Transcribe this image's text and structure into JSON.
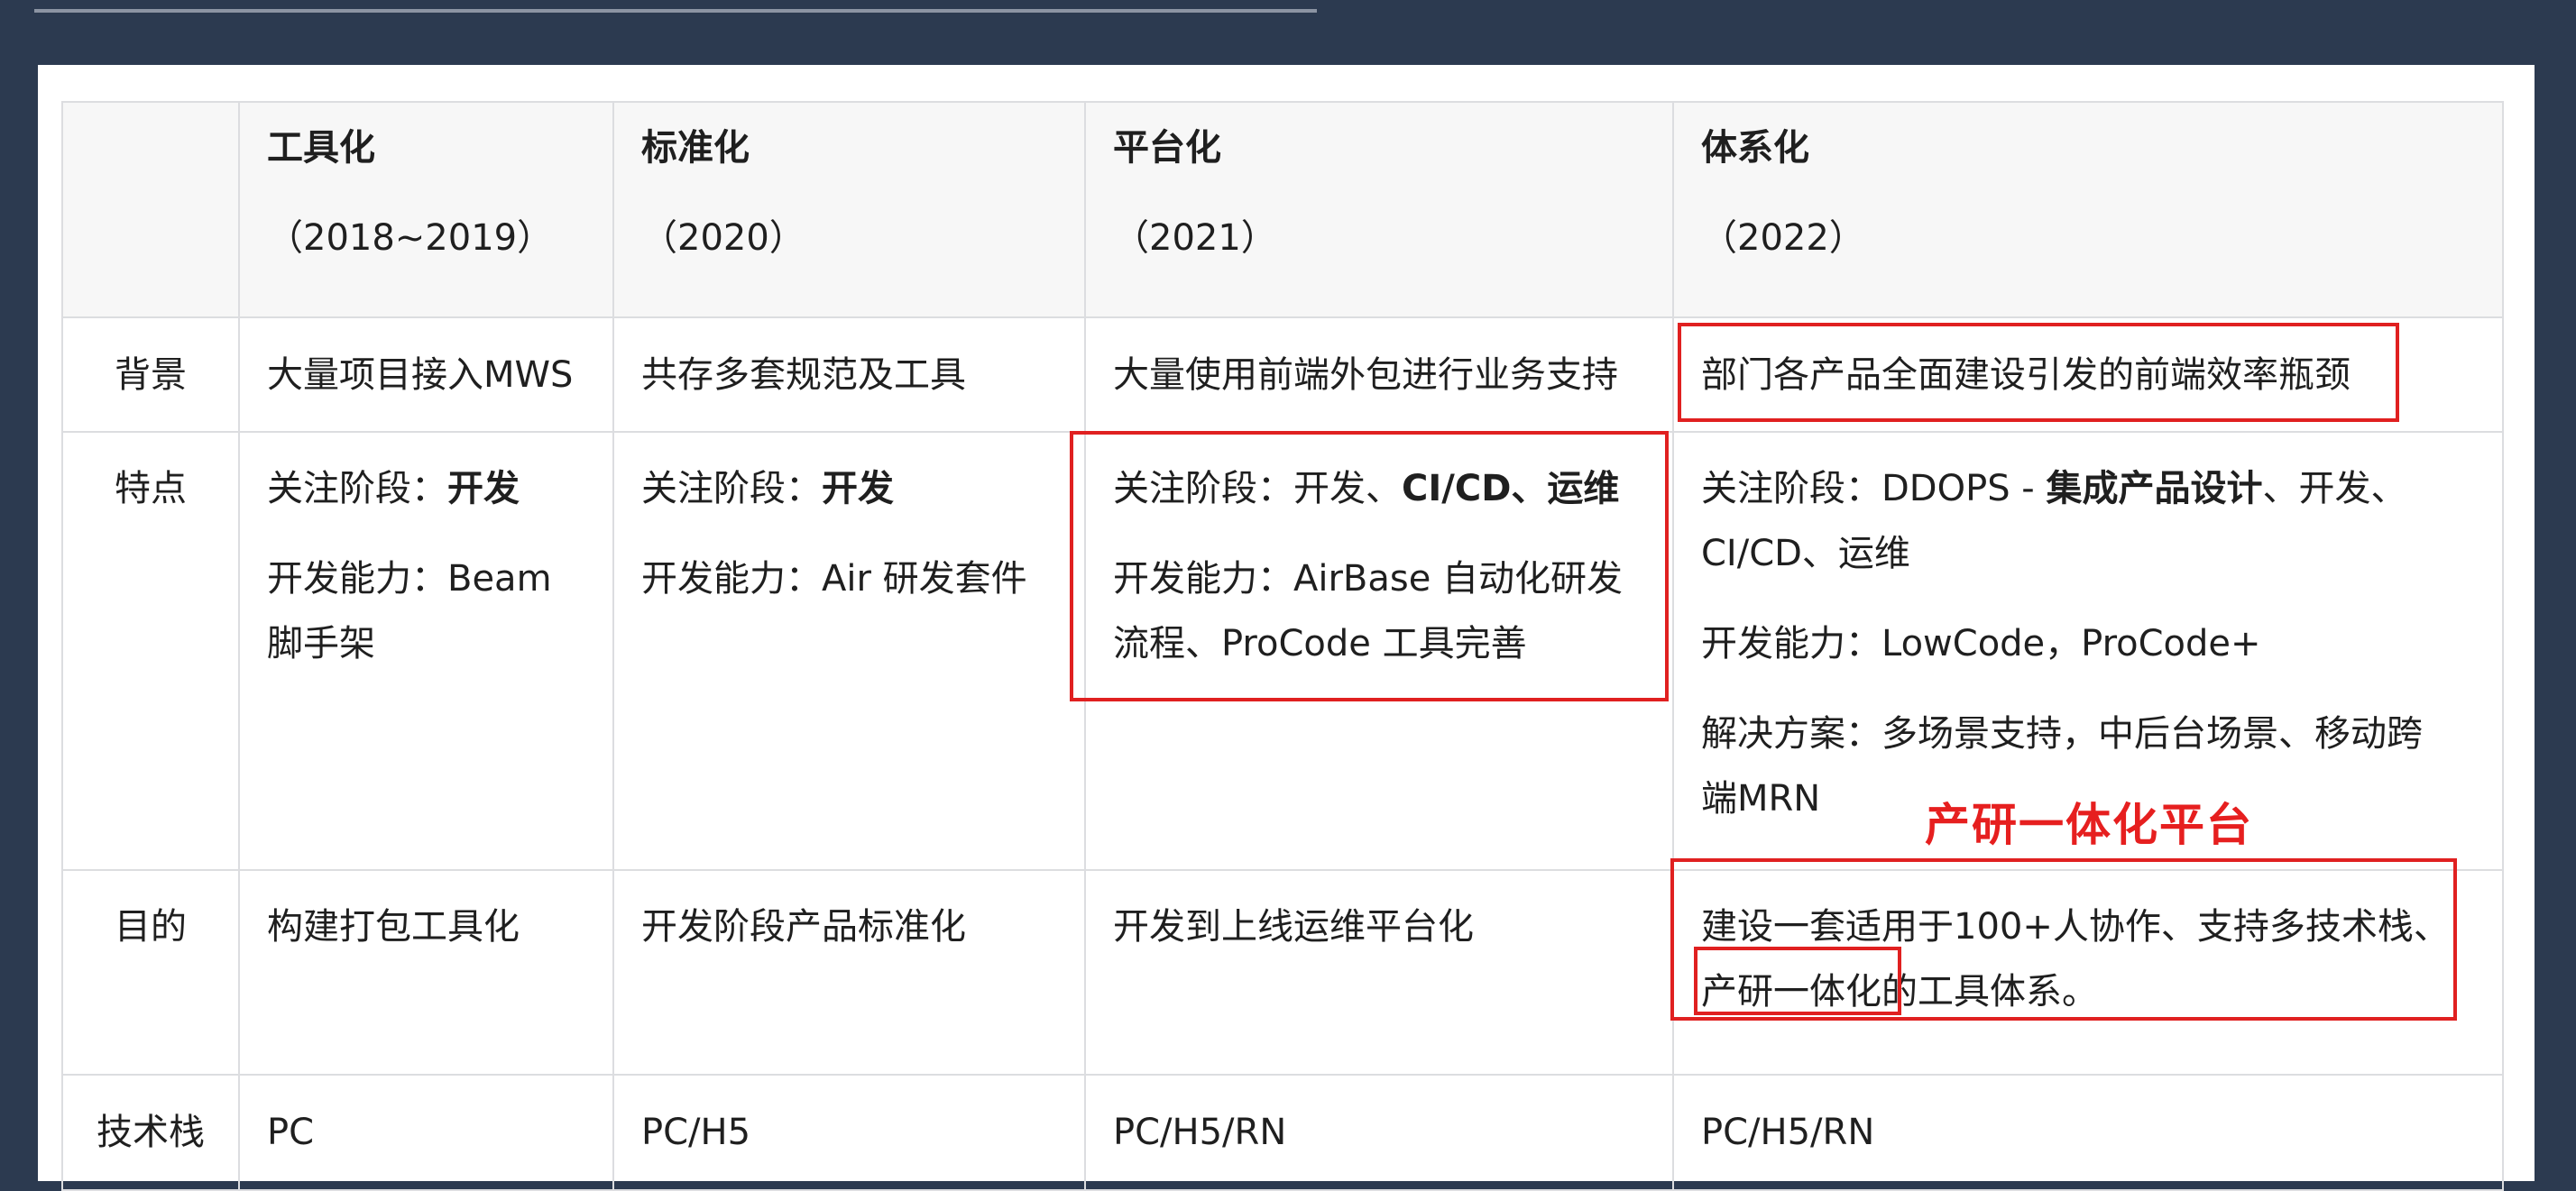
{
  "stages": [
    {
      "title": "工具化",
      "years": "（2018~2019）"
    },
    {
      "title": "标准化",
      "years": "（2020）"
    },
    {
      "title": "平台化",
      "years": "（2021）"
    },
    {
      "title": "体系化",
      "years": "（2022）"
    }
  ],
  "rows": {
    "background": {
      "label": "背景",
      "cells": [
        "大量项目接入MWS",
        "共存多套规范及工具",
        "大量使用前端外包进行业务支持",
        "部门各产品全面建设引发的前端效率瓶颈"
      ]
    },
    "features": {
      "label": "特点",
      "c1": {
        "focus_label": "关注阶段：",
        "focus_value": "开发",
        "ability_label": "开发能力：",
        "ability_value": "Beam",
        "ability_value2": "脚手架"
      },
      "c2": {
        "focus_label": "关注阶段：",
        "focus_value": "开发",
        "ability_label": "开发能力：",
        "ability_value": "Air 研发套件"
      },
      "c3": {
        "focus_label": "关注阶段：",
        "focus_value_plain": "开发、",
        "focus_value_bold": "CI/CD、运维",
        "ability_line1": "开发能力：AirBase 自动化研发",
        "ability_line2": "流程、ProCode 工具完善"
      },
      "c4": {
        "focus_label": "关注阶段：DDOPS - ",
        "focus_bold": "集成产品设计",
        "focus_rest": "、开发、",
        "focus_line2": "CI/CD、运维",
        "ability": "开发能力：LowCode，ProCode+",
        "solution_line1": "解决方案：多场景支持，中后台场景、移动跨",
        "solution_line2": "端MRN"
      }
    },
    "goal": {
      "label": "目的",
      "cells": [
        "构建打包工具化",
        "开发阶段产品标准化",
        "开发到上线运维平台化"
      ],
      "c4_line1": "建设一套适用于100+人协作、支持多技术栈、",
      "c4_line2_highlight": "产研一体化",
      "c4_line2_rest": "的工具体系。"
    },
    "tech": {
      "label": "技术栈",
      "cells": [
        "PC",
        "PC/H5",
        "PC/H5/RN",
        "PC/H5/RN"
      ]
    }
  },
  "callout": "产研一体化平台",
  "colors": {
    "highlight": "#e02020",
    "page_bg": "#2c3a50",
    "header_bg": "#f7f7f7"
  }
}
